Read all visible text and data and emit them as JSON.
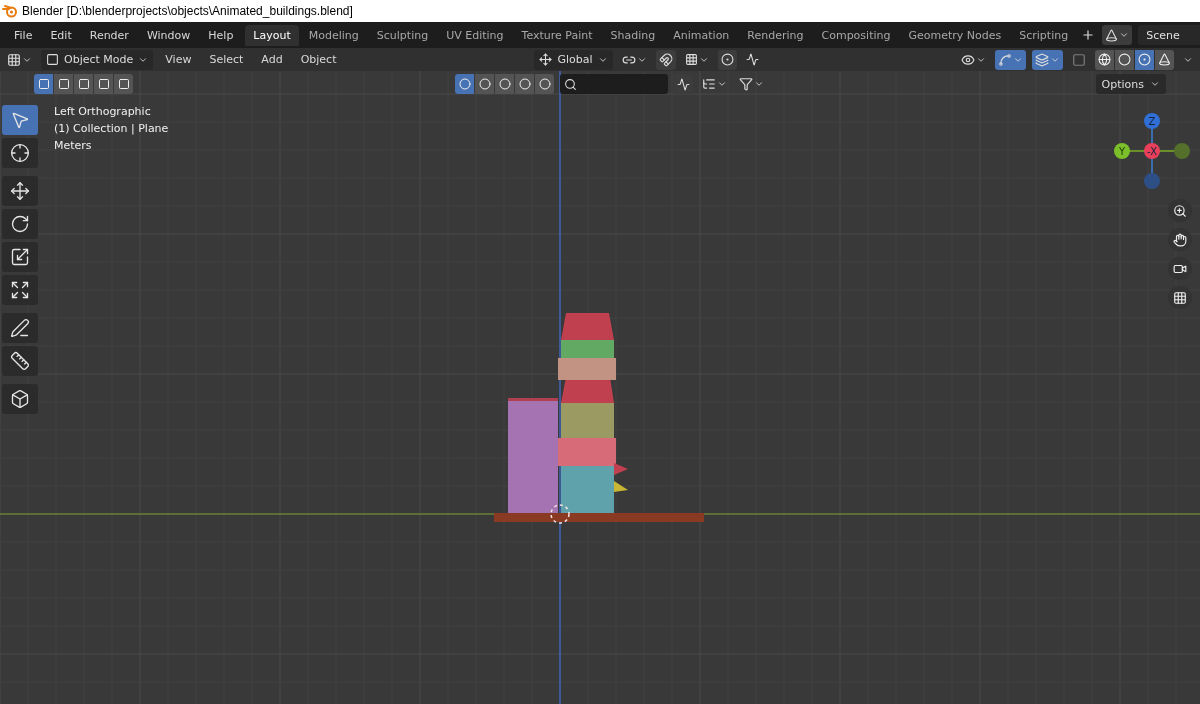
{
  "window": {
    "title": "Blender [D:\\blenderprojects\\objects\\Animated_buildings.blend]"
  },
  "menu": [
    "File",
    "Edit",
    "Render",
    "Window",
    "Help"
  ],
  "workspaces": [
    {
      "label": "Layout",
      "selected": true
    },
    {
      "label": "Modeling",
      "selected": false
    },
    {
      "label": "Sculpting",
      "selected": false
    },
    {
      "label": "UV Editing",
      "selected": false
    },
    {
      "label": "Texture Paint",
      "selected": false
    },
    {
      "label": "Shading",
      "selected": false
    },
    {
      "label": "Animation",
      "selected": false
    },
    {
      "label": "Rendering",
      "selected": false
    },
    {
      "label": "Compositing",
      "selected": false
    },
    {
      "label": "Geometry Nodes",
      "selected": false
    },
    {
      "label": "Scripting",
      "selected": false
    }
  ],
  "scene": {
    "label": "Scene"
  },
  "header": {
    "mode": "Object Mode",
    "menus": [
      "View",
      "Select",
      "Add",
      "Object"
    ],
    "orientation": "Global"
  },
  "viewport_toggles": [
    {
      "kind": "gizmos",
      "on": true
    },
    {
      "kind": "overlays",
      "on": true
    },
    {
      "kind": "xray",
      "on": false
    }
  ],
  "shading_modes": [
    {
      "kind": "wireframe",
      "selected": false
    },
    {
      "kind": "solid",
      "selected": false
    },
    {
      "kind": "material",
      "selected": true
    },
    {
      "kind": "rendered",
      "selected": false
    }
  ],
  "select_modes": [
    {
      "selected": true
    },
    {
      "selected": false
    },
    {
      "selected": false
    },
    {
      "selected": false
    },
    {
      "selected": false
    }
  ],
  "display_buttons": [
    {
      "selected": true
    },
    {
      "selected": false
    },
    {
      "selected": false
    },
    {
      "selected": false
    },
    {
      "selected": false
    }
  ],
  "options": {
    "label": "Options"
  },
  "viewport_info": [
    "Left Orthographic",
    "(1) Collection | Plane",
    "Meters"
  ],
  "tool_groups": [
    [
      {
        "selected": true
      },
      {
        "selected": false
      }
    ],
    [
      {
        "selected": false
      },
      {
        "selected": false
      },
      {
        "selected": false
      },
      {
        "selected": false
      }
    ],
    [
      {
        "selected": false
      },
      {
        "selected": false
      }
    ],
    [
      {
        "selected": false
      }
    ]
  ],
  "gizmo_axes": [
    {
      "label": "Z"
    },
    {
      "label": "Y"
    },
    {
      "label": "-X"
    }
  ]
}
